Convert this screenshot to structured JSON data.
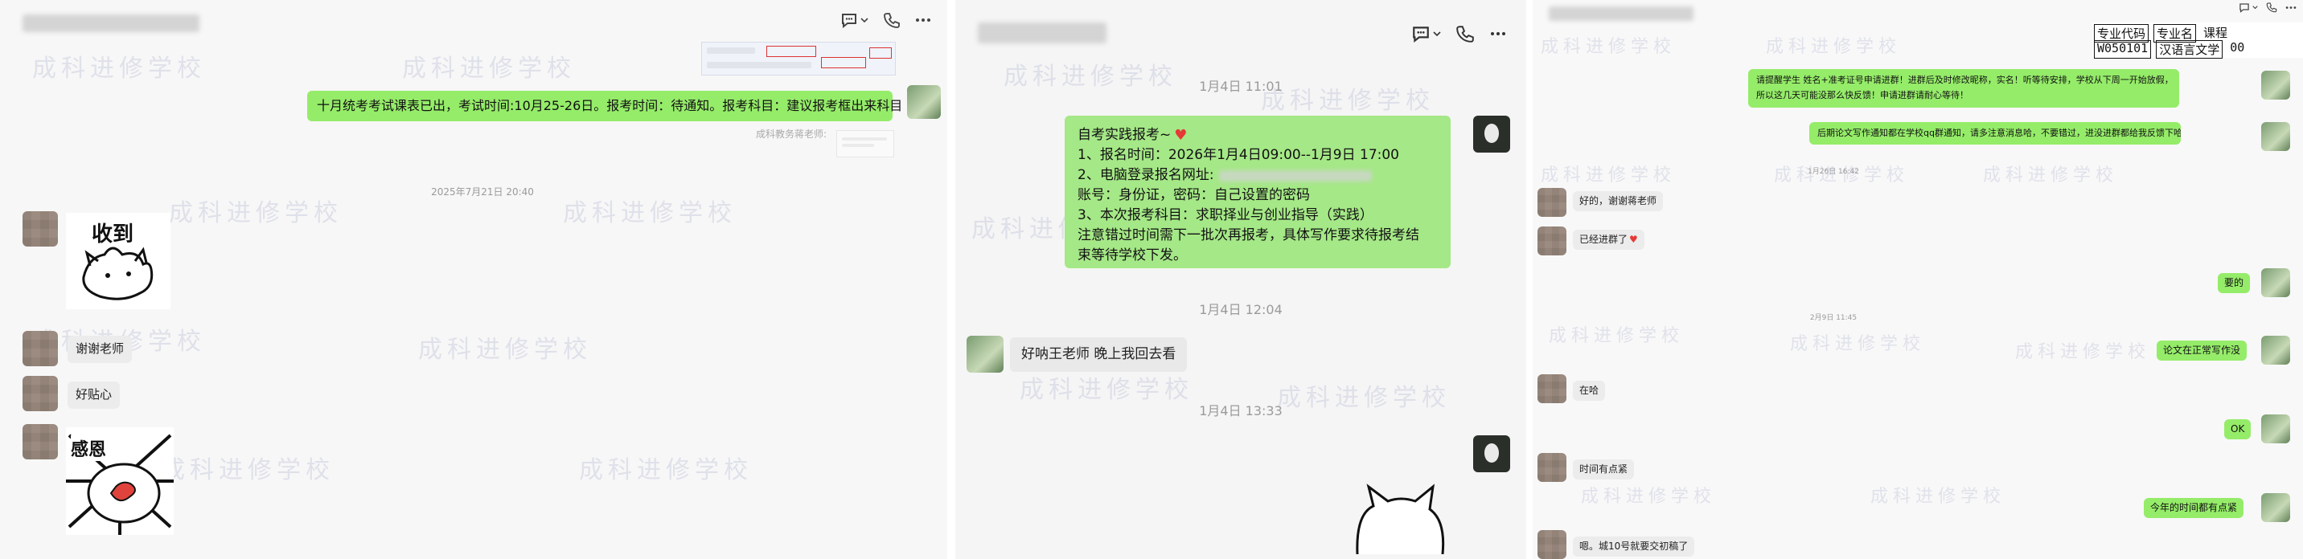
{
  "panel1": {
    "system_msg": "十月统考考试课表已出，考试时间:10月25-26日。报考时间：待通知。报考科目：建议报考框出来科目",
    "quoted_sender": "成科教务蒋老师:",
    "timestamp": "2025年7月21日 20:40",
    "sticker_received_text": "收到",
    "msg_thanks": "谢谢老师",
    "msg_sweet": "好贴心",
    "sticker_grateful_text": "感恩"
  },
  "panel2": {
    "time1": "1月4日 11:01",
    "notice_lines": [
      "自考实践报考~",
      "1、报名时间：2026年1月4日09:00--1月9日 17:00",
      "2、电脑登录报名网址:",
      "账号：身份证，密码：自己设置的密码",
      "3、本次报考科目：求职择业与创业指导（实践）",
      "注意错过时间需下一批次再报考，具体写作要求待报考结",
      "束等待学校下发。"
    ],
    "time2": "1月4日 12:04",
    "reply": "好呐王老师 晚上我回去看",
    "time3": "1月4日 13:33"
  },
  "panel3": {
    "table_header": [
      "专业代码",
      "专业名",
      "课程"
    ],
    "table_row": [
      "W050101",
      "汉语言文学",
      "00"
    ],
    "notice1_lines": [
      "请提醒学生 姓名+准考证号申请进群！进群后及时修改昵称，实名！听等待安排，学校从下周一开始放假，",
      "所以这几天可能没那么快反馈！申请进群请耐心等待！"
    ],
    "notice2": "后期论文写作通知都在学校qq群通知，请多注意消息哈，不要错过，进没进群都给我反馈下哈",
    "time1": "1月26日 16:42",
    "msg_ok_teacher": "好的，谢谢蒋老师",
    "msg_joined": "已经进群了",
    "msg_yes": "要的",
    "time2": "2月9日 11:45",
    "msg_thesis": "论文在正常写作没",
    "msg_here": "在哈",
    "msg_tight": "时间有点紧",
    "msg_ok": "OK",
    "msg_this_year": "今年的时间都有点紧",
    "msg_last": "嗯。城10号就要交初稿了"
  },
  "watermark": "成科进修学校",
  "colors": {
    "bubble_green": "#95ec69",
    "bubble_white": "#ececec",
    "timestamp": "#9a9a9a"
  }
}
